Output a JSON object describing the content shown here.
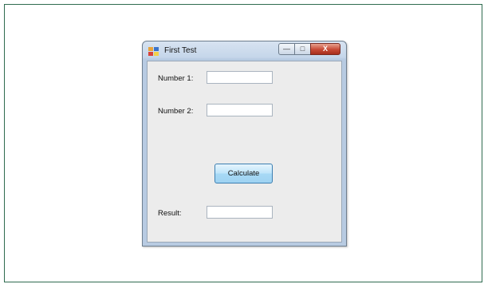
{
  "window": {
    "title": "First Test",
    "controls": {
      "minimize": "—",
      "maximize": "□",
      "close": "X"
    }
  },
  "form": {
    "number1_label": "Number 1:",
    "number1_value": "",
    "number2_label": "Number 2:",
    "number2_value": "",
    "calculate_label": "Calculate",
    "result_label": "Result:",
    "result_value": ""
  }
}
